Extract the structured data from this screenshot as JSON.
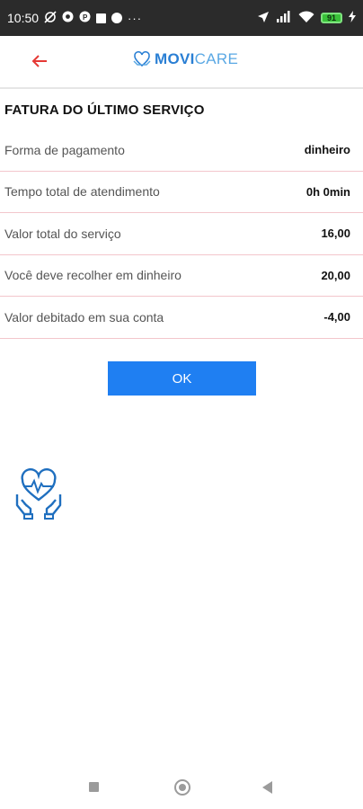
{
  "status_bar": {
    "time": "10:50",
    "dots": "···",
    "battery": "91"
  },
  "app_bar": {
    "logo_movi": "MOVI",
    "logo_care": "CARE"
  },
  "invoice": {
    "title": "FATURA DO ÚLTIMO SERVIÇO",
    "rows": [
      {
        "label": "Forma de pagamento",
        "value": "dinheiro"
      },
      {
        "label": "Tempo total de atendimento",
        "value": "0h 0min"
      },
      {
        "label": "Valor total do serviço",
        "value": "16,00"
      },
      {
        "label": "Você deve recolher em dinheiro",
        "value": "20,00"
      },
      {
        "label": "Valor debitado em sua conta",
        "value": "-4,00"
      }
    ]
  },
  "ok_button_label": "OK",
  "colors": {
    "primary_blue": "#1f7ff2",
    "back_arrow_red": "#e53935",
    "divider_pink": "#f3c6cc",
    "status_bar": "#2b2b2b"
  },
  "icons": [
    "back-arrow-icon",
    "movicare-logo-icon",
    "heart-in-hands-icon",
    "wifi-icon",
    "signal-icon",
    "location-icon"
  ]
}
